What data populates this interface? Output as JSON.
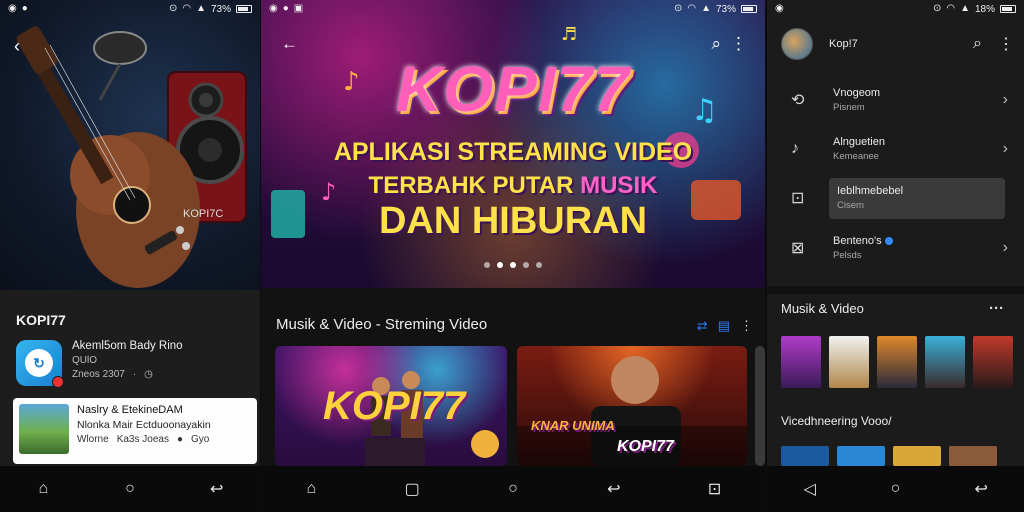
{
  "panel1": {
    "status": {
      "time": "",
      "battery": "73%"
    },
    "hero_tag": "KOPI7C",
    "app_title": "KOPI77",
    "item1": {
      "title": "Akeml5om Bady Rino",
      "sub": "QUlO",
      "meta_date": "Zneos 2307",
      "meta_sep": "·"
    },
    "item2": {
      "title": "Naslry & EtekineDAM",
      "sub": "Nlonka Mair Ectduoonayakin",
      "meta_a": "Wlorne",
      "meta_b": "Ka3s Joeas",
      "meta_c": "Gyo"
    },
    "nav": {
      "home": "home",
      "recents": "circle",
      "back": "back"
    }
  },
  "panel2": {
    "status": {
      "battery": "73%"
    },
    "hero": {
      "title": "KOPI77",
      "line1": "APLIKASI STREAMING VIDEO",
      "line2_a": "TERBAHK",
      "line2_b": "PUTAR",
      "line2_c": "MUSIK",
      "line3": "DAN HIBURAN"
    },
    "section_title": "Musik & Video - Streming Video",
    "card1_logo": "KOPI77",
    "card2_logo": "KOPI77",
    "card2_tag": "KNAR UNIMA"
  },
  "panel3": {
    "status": {
      "battery": "18%"
    },
    "profile_name": "Kop!7",
    "menu": [
      {
        "title": "Vnogeom",
        "sub": "Pisnem"
      },
      {
        "title": "Alnguetien",
        "sub": "Kemeanee"
      },
      {
        "title": "Ieblhmebebel",
        "sub": "Cisem"
      },
      {
        "title": "Benteno's",
        "sub": "Pelsds"
      }
    ],
    "section1": "Musik & Video",
    "section2": "Vicedhneering Vooo/"
  }
}
